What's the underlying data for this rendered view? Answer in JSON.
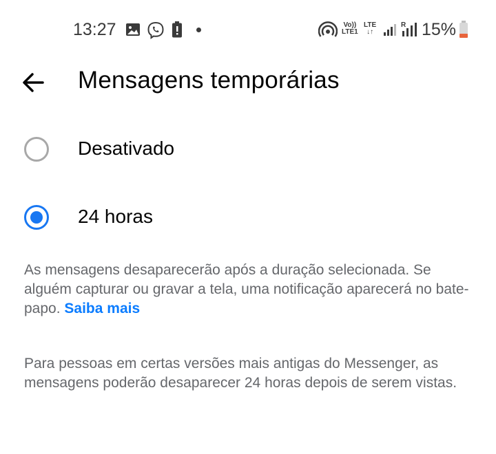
{
  "status_bar": {
    "time": "13:27",
    "battery": "15%",
    "network_volte": "Vo))",
    "network_lte1": "LTE1",
    "network_lte": "LTE",
    "icons": [
      "gallery-icon",
      "viber-icon",
      "battery-alert-icon",
      "notification-dot-icon",
      "hotspot-icon",
      "volte-icon",
      "lte-icon",
      "signal-icon",
      "roaming-signal-icon",
      "battery-icon"
    ],
    "colors": {
      "battery_low": "#e8643c"
    }
  },
  "header": {
    "title": "Mensagens temporárias",
    "back_icon": "back-arrow-icon"
  },
  "options": [
    {
      "label": "Desativado",
      "selected": false
    },
    {
      "label": "24 horas",
      "selected": true
    }
  ],
  "info": {
    "text": "As mensagens desaparecerão após a duração selecionada. Se alguém capturar ou gravar a tela, uma notificação aparecerá no bate-papo.",
    "link": "Saiba mais",
    "note": "Para pessoas em certas versões mais antigas do Messenger, as mensagens poderão desaparecer 24 horas depois de serem vistas."
  },
  "colors": {
    "accent": "#1877f2",
    "link": "#0a7cff",
    "secondary_text": "#65676b",
    "radio_off": "#a8a8a8"
  }
}
